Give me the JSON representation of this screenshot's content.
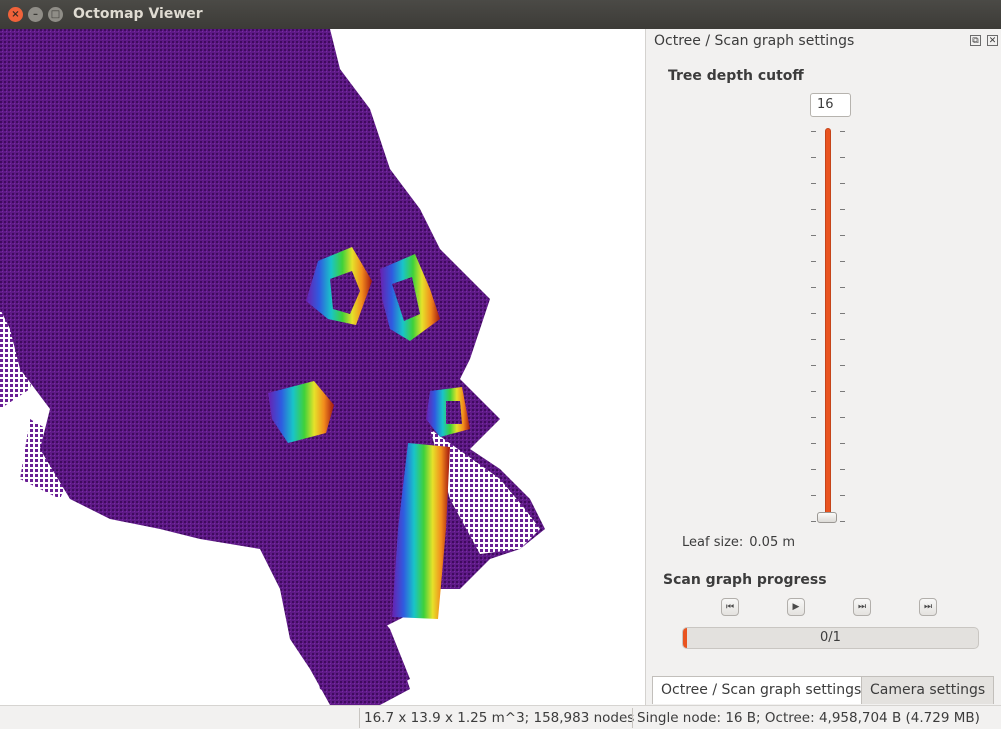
{
  "window": {
    "title": "Octomap Viewer",
    "close_glyph": "×",
    "minimize_glyph": "–",
    "maximize_glyph": "□"
  },
  "dock": {
    "title": "Octree / Scan graph settings",
    "float_glyph": "⧉",
    "close_glyph": "✕",
    "tree_depth_label": "Tree depth cutoff",
    "tree_depth_value": "16",
    "tree_depth_slider_level": 1.0,
    "leaf_size_label": "Leaf size:",
    "leaf_size_value": "0.05 m",
    "scan_progress_label": "Scan graph progress",
    "scan_buttons": [
      {
        "name": "first-scan-icon",
        "glyph": "⏮"
      },
      {
        "name": "play-icon",
        "glyph": "▶"
      },
      {
        "name": "next-scan-icon",
        "glyph": "⏭"
      },
      {
        "name": "last-scan-icon",
        "glyph": "⏭"
      }
    ],
    "progress_text": "0/1",
    "progress_fraction": 0.0
  },
  "tabs": [
    {
      "label": "Octree / Scan graph settings",
      "active": true
    },
    {
      "label": "Camera settings",
      "active": false
    }
  ],
  "status": {
    "dimensions": "16.7 x 13.9 x 1.25 m^3; 158,983 nodes",
    "memory": "Single node: 16 B; Octree: 4,958,704 B (4.729 MB)"
  },
  "colors": {
    "occupied_voxels": "#5a1480",
    "accent": "#e95420"
  }
}
